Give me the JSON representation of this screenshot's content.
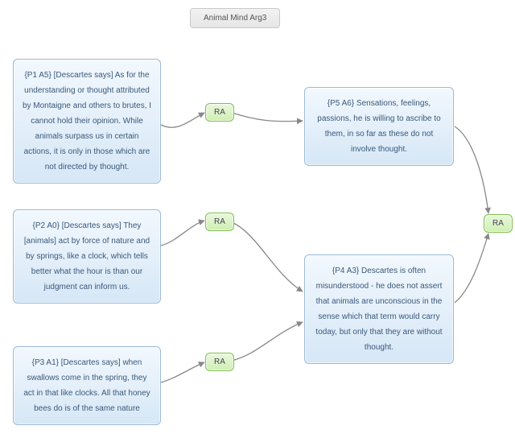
{
  "title": "Animal Mind Arg3",
  "ra_label": "RA",
  "nodes": {
    "p1": "{P1 A5} [Descartes says] As for the understanding or thought attributed by Montaigne and others to brutes, I cannot hold their opinion. While animals surpass us in certain actions, it is only in those which are not directed by thought.",
    "p2": "{P2 A0} [Descartes says] They [animals] act by force of nature and by springs, like a clock, which tells better what the hour is than our judgment can inform us.",
    "p3": "{P3 A1} [Descartes says] when swallows come in the spring, they act in that like clocks. All that honey bees do is of the same nature",
    "p4": "{P4 A3} Descartes is often misunderstood - he does not assert that animals are unconscious in the sense which that term would carry today, but only that they are without thought.",
    "p5": "{P5 A6} Sensations, feelings, passions, he is willing to ascribe to them, in so far as these do not involve thought."
  }
}
